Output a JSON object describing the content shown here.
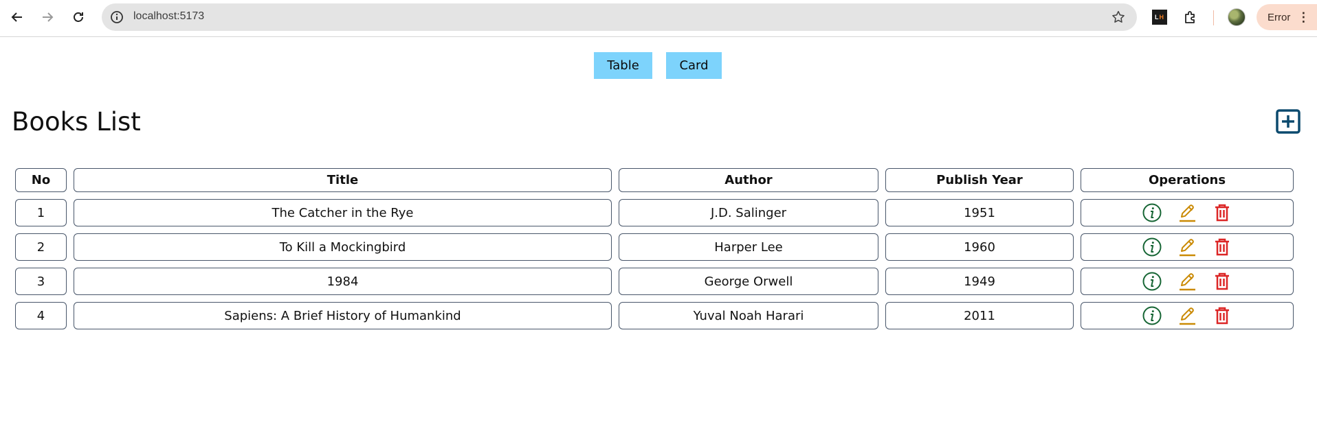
{
  "browser": {
    "url": "localhost:5173",
    "profile_status": "Error",
    "icons": {
      "back": "back-arrow-icon",
      "forward": "forward-arrow-icon",
      "reload": "reload-icon",
      "site_info": "info-icon",
      "bookmark": "star-icon",
      "extension": "puzzle-icon",
      "menu": "kebab-menu-icon"
    },
    "extension_badge": {
      "left": "L",
      "right": "H"
    }
  },
  "view_toggle": {
    "table_label": "Table",
    "card_label": "Card",
    "color": "#7dd3fc"
  },
  "page": {
    "title": "Books List",
    "add_icon": "plus-square-icon",
    "add_icon_color": "#0c4a6e"
  },
  "table": {
    "headers": [
      "No",
      "Title",
      "Author",
      "Publish Year",
      "Operations"
    ],
    "rows": [
      {
        "no": "1",
        "title": "The Catcher in the Rye",
        "author": "J.D. Salinger",
        "year": "1951"
      },
      {
        "no": "2",
        "title": "To Kill a Mockingbird",
        "author": "Harper Lee",
        "year": "1960"
      },
      {
        "no": "3",
        "title": "1984",
        "author": "George Orwell",
        "year": "1949"
      },
      {
        "no": "4",
        "title": "Sapiens: A Brief History of Humankind",
        "author": "Yuval Noah Harari",
        "year": "2011"
      }
    ],
    "operation_icons": [
      {
        "name": "info-circle-icon",
        "color": "#166534"
      },
      {
        "name": "edit-pencil-icon",
        "color": "#ca8a04"
      },
      {
        "name": "trash-icon",
        "color": "#dc2626"
      }
    ]
  }
}
